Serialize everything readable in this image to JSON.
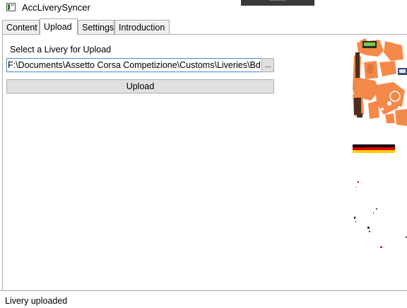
{
  "window": {
    "title": "AccLiverySyncer"
  },
  "tabs": [
    {
      "label": "Content"
    },
    {
      "label": "Upload"
    },
    {
      "label": "Settings"
    },
    {
      "label": "Introduction"
    }
  ],
  "active_tab": "Upload",
  "upload": {
    "select_label": "Select a Livery for Upload",
    "path_value": "F:\\Documents\\Assetto Corsa Competizione\\Customs\\Liveries\\BdfmF",
    "browse_label": "...",
    "upload_button_label": "Upload"
  },
  "status": {
    "text": "Livery uploaded"
  },
  "colors": {
    "livery_orange": "#f5894a",
    "input_focus_border": "#4a8bd4",
    "button_face": "#e1e1e1",
    "border_gray": "#acacac"
  }
}
